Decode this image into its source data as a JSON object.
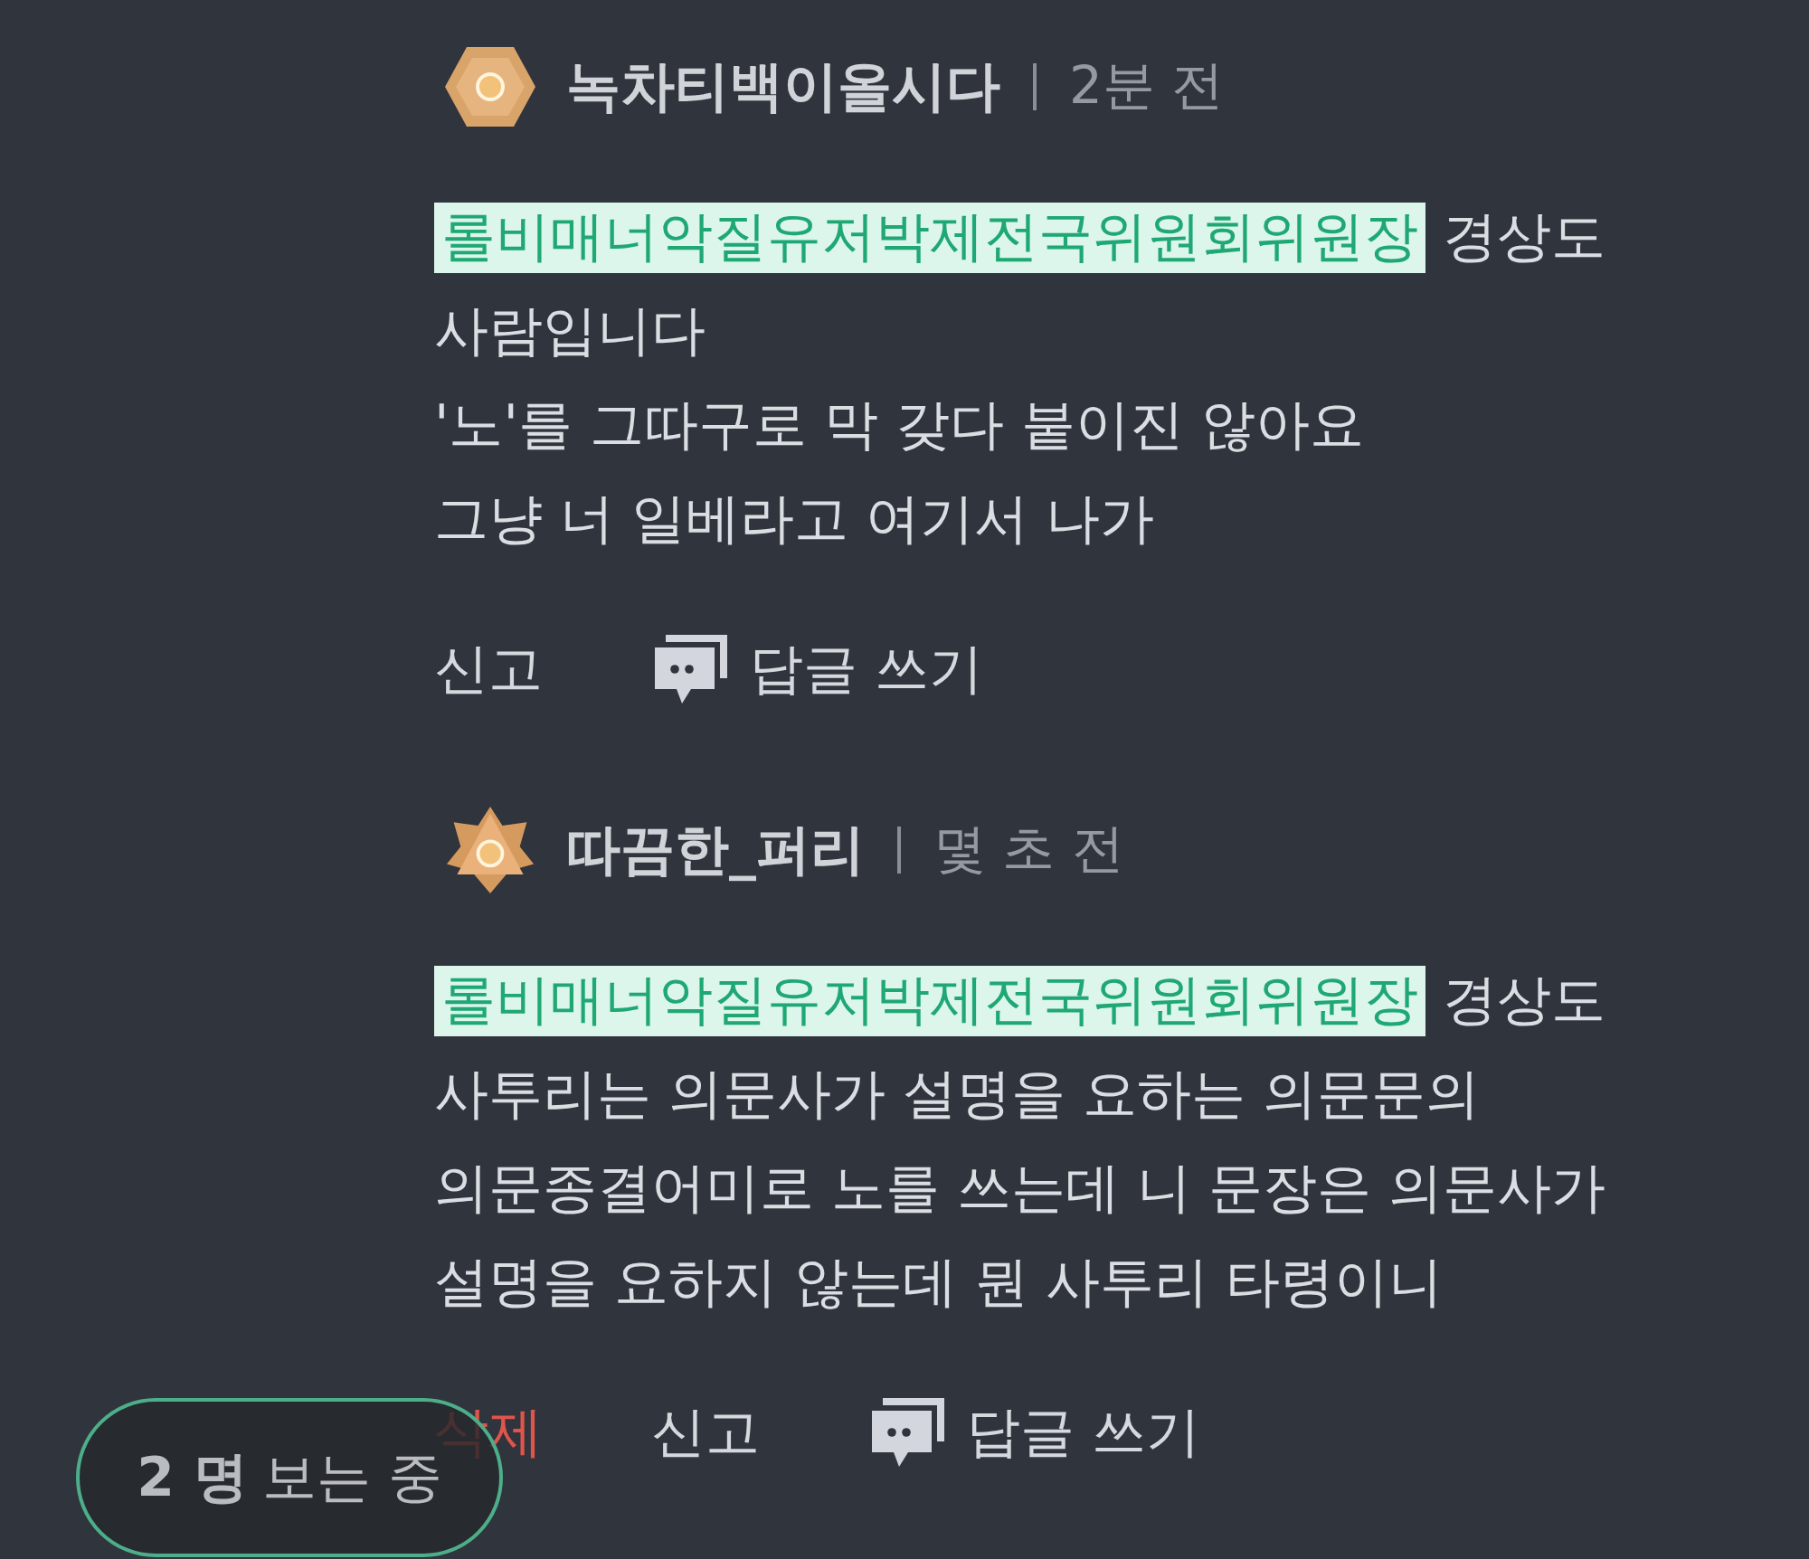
{
  "comments": [
    {
      "kind": "hexagon",
      "author": "녹차티백이올시다",
      "time": "2분 전",
      "mention": "롤비매너악질유저박제전국위원회위원장",
      "text": "경상도 사람입니다\n'노'를 그따구로 막 갖다 붙이진 않아요\n그냥 너 일베라고 여기서 나가",
      "actions": [
        {
          "kind": "report",
          "label": "신고"
        },
        {
          "kind": "reply",
          "label": "답글 쓰기"
        }
      ]
    },
    {
      "kind": "star",
      "author": "따끔한_퍼리",
      "time": "몇 초 전",
      "mention": "롤비매너악질유저박제전국위원회위원장",
      "text": "경상도 사투리는 의문사가 설명을 요하는 의문문의 의문종결어미로 노를 쓰는데 니 문장은 의문사가 설명을 요하지 않는데 뭔 사투리 타령이니",
      "actions": [
        {
          "kind": "delete",
          "label": "삭제"
        },
        {
          "kind": "report",
          "label": "신고"
        },
        {
          "kind": "reply",
          "label": "답글 쓰기"
        }
      ]
    }
  ],
  "viewers": {
    "count": "2 명",
    "label": "보는 중"
  }
}
